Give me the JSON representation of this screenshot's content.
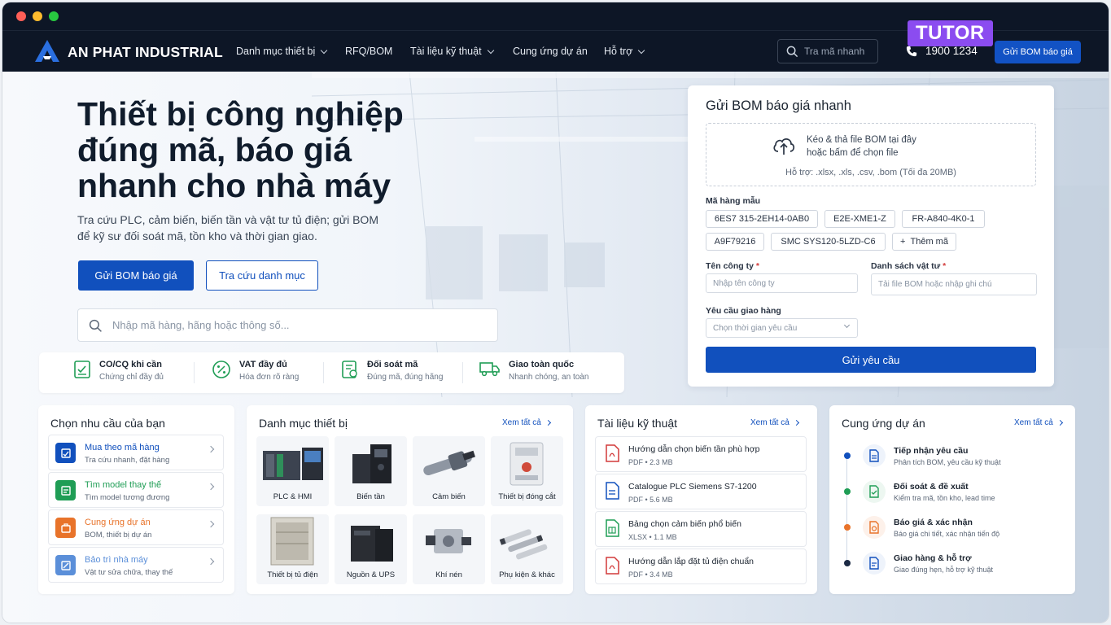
{
  "nav": {
    "brand": "AN PHAT INDUSTRIAL",
    "menu": [
      {
        "label": "Danh mục thiết bị"
      },
      {
        "label": "RFQ/BOM"
      },
      {
        "label": "Tài liệu kỹ thuật"
      },
      {
        "label": "Cung ứng dự án"
      },
      {
        "label": "Hỗ trợ"
      }
    ],
    "search_placeholder": "Tra mã nhanh",
    "phone": "1900 1234",
    "cta": "Gửi BOM báo giá",
    "watermark": "TUTOR"
  },
  "hero": {
    "title": "Thiết bị công nghiệp đúng mã, báo giá nhanh cho nhà máy",
    "subtitle": "Tra cứu PLC, cảm biến, biến tần và vật tư tủ điện; gửi BOM để kỹ sư đối soát mã, tồn kho và thời gian giao.",
    "primary_button": "Gửi BOM báo giá",
    "secondary_button": "Tra cứu danh mục",
    "search_placeholder": "Nhập mã hàng, hãng hoặc thông số..."
  },
  "features": [
    {
      "title": "CO/CQ khi cần",
      "sub": "Chứng chỉ đầy đủ"
    },
    {
      "title": "VAT đầy đủ",
      "sub": "Hóa đơn rõ ràng"
    },
    {
      "title": "Đối soát mã",
      "sub": "Đúng mã, đúng hãng"
    },
    {
      "title": "Giao toàn quốc",
      "sub": "Nhanh chóng, an toàn"
    }
  ],
  "form": {
    "title": "Gửi BOM báo giá nhanh",
    "drop_line1": "Kéo & thả file BOM tại đây",
    "drop_line2": "hoặc bấm để chọn file",
    "drop_support": "Hỗ trợ: .xlsx, .xls, .csv, .bom (Tối đa 20MB)",
    "sample_label": "Mã hàng mẫu",
    "chips": [
      "6ES7 315-2EH14-0AB0",
      "E2E-XME1-Z",
      "FR-A840-4K0-1",
      "A9F79216",
      "SMC SYS120-5LZD-C6"
    ],
    "add_chip": "Thêm mã",
    "company_label": "Tên công ty",
    "company_placeholder": "Nhập tên công ty",
    "list_label": "Danh sách vật tư",
    "list_placeholder": "Tải file BOM hoặc nhập ghi chú",
    "delivery_label": "Yêu cầu giao hàng",
    "delivery_value": "Chọn thời gian yêu cầu",
    "required_mark": "*",
    "submit": "Gửi yêu cầu"
  },
  "needs": {
    "title": "Chọn nhu cầu của bạn",
    "items": [
      {
        "title": "Mua theo mã hàng",
        "sub": "Tra cứu nhanh, đặt hàng",
        "color": "#1150bd"
      },
      {
        "title": "Tìm model thay thế",
        "sub": "Tìm model tương đương",
        "color": "#1f9d55"
      },
      {
        "title": "Cung ứng dự án",
        "sub": "BOM, thiết bị dự án",
        "color": "#e8732a"
      },
      {
        "title": "Bảo trì nhà máy",
        "sub": "Vật tư sửa chữa, thay thế",
        "color": "#5b8fd9"
      }
    ]
  },
  "catalog": {
    "title": "Danh mục thiết bị",
    "see_all": "Xem tất cả",
    "items": [
      "PLC & HMI",
      "Biến tần",
      "Cảm biến",
      "Thiết bị đóng cắt",
      "Thiết bị tủ điện",
      "Nguồn & UPS",
      "Khí nén",
      "Phụ kiện & khác"
    ]
  },
  "docs": {
    "title": "Tài liệu kỹ thuật",
    "see_all": "Xem tất cả",
    "items": [
      {
        "title": "Hướng dẫn chọn biến tần phù hợp",
        "meta": "PDF • 2.3 MB",
        "type": "pdf"
      },
      {
        "title": "Catalogue PLC Siemens S7-1200",
        "meta": "PDF • 5.6 MB",
        "type": "doc"
      },
      {
        "title": "Bảng chọn cảm biến phổ biến",
        "meta": "XLSX • 1.1 MB",
        "type": "xlsx"
      },
      {
        "title": "Hướng dẫn lắp đặt tủ điện chuẩn",
        "meta": "PDF • 3.4 MB",
        "type": "pdf"
      }
    ]
  },
  "supply": {
    "title": "Cung ứng dự án",
    "see_all": "Xem tất cả",
    "steps": [
      {
        "title": "Tiếp nhận yêu cầu",
        "sub": "Phân tích BOM, yêu cầu kỹ thuật",
        "color": "#1150bd"
      },
      {
        "title": "Đối soát & đề xuất",
        "sub": "Kiểm tra mã, tồn kho, lead time",
        "color": "#1f9d55"
      },
      {
        "title": "Báo giá & xác nhận",
        "sub": "Báo giá chi tiết, xác nhận tiến độ",
        "color": "#e8732a"
      },
      {
        "title": "Giao hàng & hỗ trợ",
        "sub": "Giao đúng hẹn, hỗ trợ kỹ thuật",
        "color": "#1b2a44"
      }
    ]
  },
  "colors": {
    "accent": "#1150bd",
    "nav_bg": "#0d1626"
  }
}
